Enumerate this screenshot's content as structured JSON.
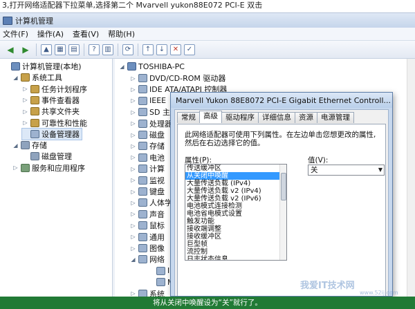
{
  "caption": "3,打开网络适配器下拉菜单,选择第二个  Mvarvell yukon88E072 PCI-E 双击",
  "window": {
    "title": "计算机管理",
    "menu": [
      "文件(F)",
      "操作(A)",
      "查看(V)",
      "帮助(H)"
    ]
  },
  "left_tree": [
    {
      "label": "计算机管理(本地)",
      "indent": 0,
      "expander": "",
      "icon": "comp"
    },
    {
      "label": "系统工具",
      "indent": 1,
      "expander": "◢",
      "icon": "tool"
    },
    {
      "label": "任务计划程序",
      "indent": 2,
      "expander": "▷",
      "icon": "tool"
    },
    {
      "label": "事件查看器",
      "indent": 2,
      "expander": "▷",
      "icon": "tool"
    },
    {
      "label": "共享文件夹",
      "indent": 2,
      "expander": "▷",
      "icon": "tool"
    },
    {
      "label": "可靠性和性能",
      "indent": 2,
      "expander": "▷",
      "icon": "tool"
    },
    {
      "label": "设备管理器",
      "indent": 2,
      "expander": "",
      "icon": "dev"
    },
    {
      "label": "存储",
      "indent": 1,
      "expander": "◢",
      "icon": "store"
    },
    {
      "label": "磁盘管理",
      "indent": 2,
      "expander": "",
      "icon": "store"
    },
    {
      "label": "服务和应用程序",
      "indent": 1,
      "expander": "▷",
      "icon": "svc"
    }
  ],
  "device_tree": {
    "root": "TOSHIBA-PC",
    "items": [
      "DVD/CD-ROM 驱动器",
      "IDE ATA/ATAPI 控制器",
      "IEEE",
      "SD 主",
      "处理器",
      "磁盘",
      "存储",
      "电池",
      "计算",
      "监视",
      "键盘",
      "人体学",
      "声音",
      "鼠标",
      "通用",
      "图像",
      "网络",
      "In",
      "M",
      "系统"
    ]
  },
  "dialog": {
    "title": "Marvell Yukon 88E8072 PCI-E Gigabit Ethernet Controll...",
    "tabs": [
      "常规",
      "高级",
      "驱动程序",
      "详细信息",
      "资源",
      "电源管理"
    ],
    "active_tab": "高级",
    "description_line1": "此网络适配器可使用下列属性。在左边单击您想更改的属性,",
    "description_line2": "然后在右边选择它的值。",
    "property_label": "属性(P):",
    "value_label": "值(V):",
    "properties": [
      "传送缓冲区",
      "从关闭中唤醒",
      "大量传送负载 (IPv4)",
      "大量传送负载 v2 (IPv4)",
      "大量传送负载 v2 (IPv6)",
      "电池模式连接检测",
      "电池省电模式设置",
      "触发功能",
      "接收端调整",
      "接收缓冲区",
      "巨型帧",
      "流控制",
      "日志状态信息"
    ],
    "selected_property": "从关闭中唤醒",
    "value": "关"
  },
  "bottom_text": "将从关闭中唤醒设为“关”就行了。",
  "watermark": "我爱IT技术网",
  "watermark_url": "www.52ij.com",
  "colors": {
    "accent": "#3399ff",
    "bottom_bar": "#217a35"
  }
}
